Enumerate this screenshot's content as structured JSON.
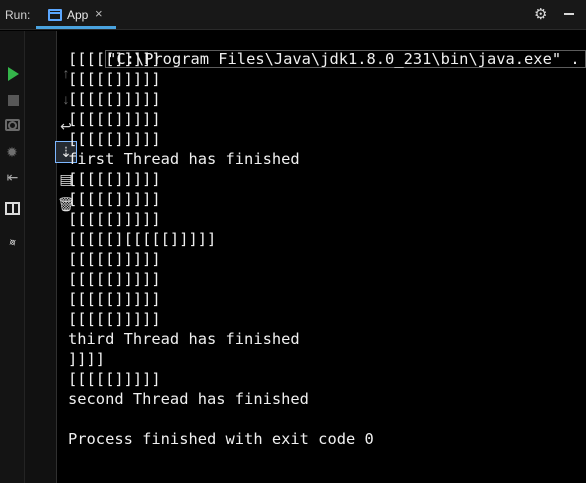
{
  "header": {
    "run_label": "Run:",
    "tab_label": "App",
    "close_symbol": "×"
  },
  "toolbar": {
    "left": [
      {
        "name": "play-icon",
        "interactable": true
      },
      {
        "name": "stop-icon",
        "interactable": true
      },
      {
        "name": "camera-icon",
        "interactable": true
      },
      {
        "name": "bug-icon",
        "interactable": true
      },
      {
        "name": "exit-icon",
        "interactable": true
      },
      {
        "name": "layout-icon",
        "interactable": true
      },
      {
        "name": "pin-icon",
        "interactable": true
      }
    ],
    "second": [
      {
        "name": "up-arrow-icon",
        "interactable": true
      },
      {
        "name": "down-arrow-icon",
        "interactable": true
      },
      {
        "name": "soft-wrap-icon",
        "interactable": true
      },
      {
        "name": "scroll-to-end-icon",
        "interactable": true
      },
      {
        "name": "print-icon",
        "interactable": true
      },
      {
        "name": "trash-icon",
        "interactable": true
      }
    ]
  },
  "console": {
    "command": "\"C:\\Program Files\\Java\\jdk1.8.0_231\\bin\\java.exe\" .",
    "lines": [
      "[[[[[]]]]]",
      "[[[[[]]]]]",
      "[[[[[]]]]]",
      "[[[[[]]]]]",
      "[[[[[]]]]]",
      "first Thread has finished",
      "[[[[[]]]]]",
      "[[[[[]]]]]",
      "[[[[[]]]]]",
      "[[[[[][[[[[]]]]]",
      "[[[[[]]]]]",
      "[[[[[]]]]]",
      "[[[[[]]]]]",
      "[[[[[]]]]]",
      "third Thread has finished",
      "]]]]",
      "[[[[[]]]]]",
      "second Thread has finished",
      "",
      "Process finished with exit code 0"
    ]
  },
  "colors": {
    "accent": "#4aa3df",
    "background": "#000000",
    "toolbar": "#141414",
    "text": "#f0f0f0",
    "run_green": "#34b54a"
  }
}
